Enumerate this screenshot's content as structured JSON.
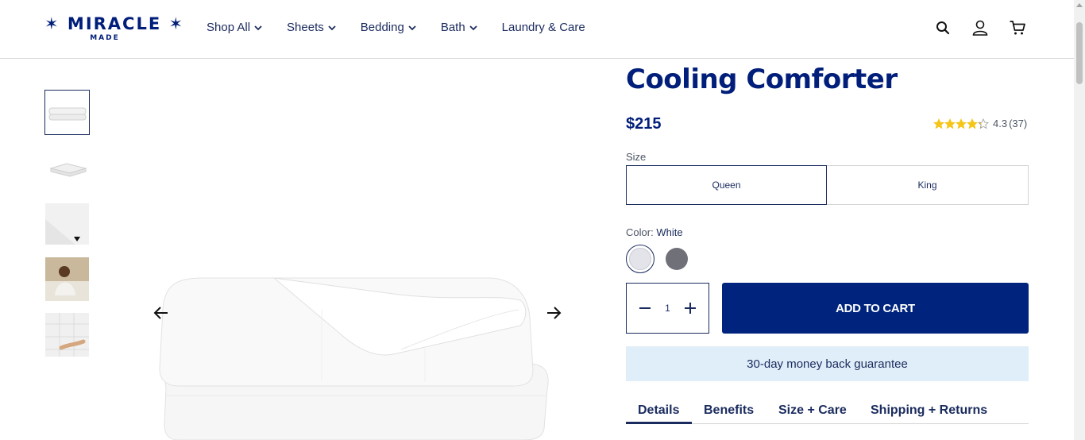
{
  "brand": {
    "name": "MIRACLE",
    "sub": "MADE",
    "color": "#001e7a"
  },
  "nav": {
    "items": [
      {
        "label": "Shop All",
        "has_dropdown": true
      },
      {
        "label": "Sheets",
        "has_dropdown": true
      },
      {
        "label": "Bedding",
        "has_dropdown": true
      },
      {
        "label": "Bath",
        "has_dropdown": true
      },
      {
        "label": "Laundry & Care",
        "has_dropdown": false
      }
    ]
  },
  "header_icons": [
    "search-icon",
    "account-icon",
    "cart-icon"
  ],
  "product": {
    "title": "Cooling Comforter",
    "price": "$215",
    "rating": {
      "value": 4.3,
      "text": "4.3",
      "count": "(37)"
    },
    "size_label": "Size",
    "sizes": [
      {
        "label": "Queen",
        "selected": true
      },
      {
        "label": "King",
        "selected": false
      }
    ],
    "color_label": "Color:",
    "color_value": "White",
    "swatches": [
      {
        "name": "White",
        "hex": "#e3e4ea",
        "selected": true
      },
      {
        "name": "Gray",
        "hex": "#6f7078",
        "selected": false
      }
    ],
    "quantity": "1",
    "add_to_cart": "ADD TO CART",
    "guarantee": "30-day money back guarantee"
  },
  "tabs": [
    {
      "label": "Details",
      "active": true
    },
    {
      "label": "Benefits",
      "active": false
    },
    {
      "label": "Size + Care",
      "active": false
    },
    {
      "label": "Shipping + Returns",
      "active": false
    }
  ],
  "colors": {
    "primary": "#00247d",
    "accent_bg": "#e0eef9",
    "star": "#f5c518"
  }
}
